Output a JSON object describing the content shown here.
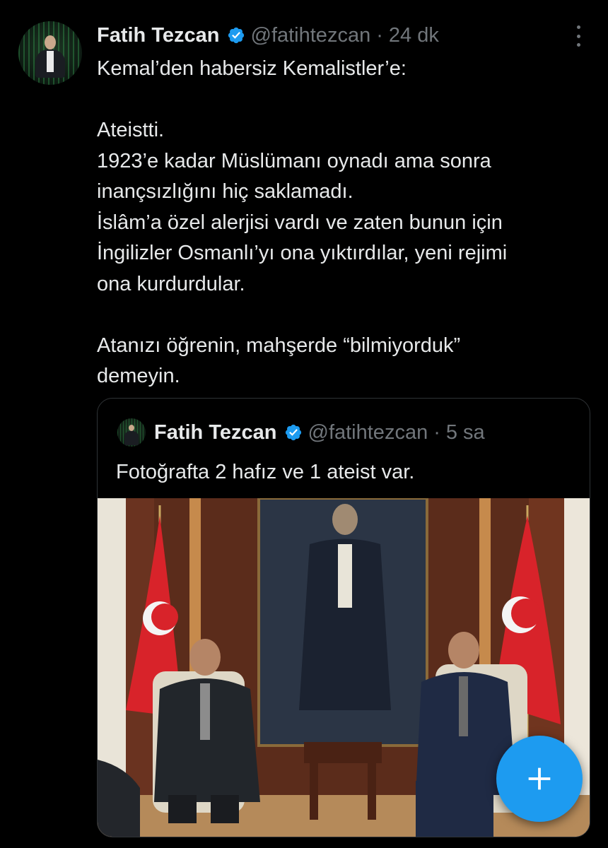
{
  "tweet": {
    "author_name": "Fatih Tezcan",
    "author_handle": "@fatihtezcan",
    "separator": "·",
    "time": "24 dk",
    "text_lines": [
      "Kemal’den habersiz Kemalistler’e:",
      "",
      "Ateistti.",
      "1923’e kadar Müslümanı oynadı ama sonra",
      "inançsızlığını hiç saklamadı.",
      "İslâm’a özel alerjisi vardı ve zaten bunun için",
      "İngilizler Osmanlı’yı ona yıktırdılar, yeni rejimi",
      "ona kurdurdular.",
      "",
      "Atanızı öğrenin, mahşerde “bilmiyorduk”",
      "demeyin."
    ]
  },
  "quote": {
    "author_name": "Fatih Tezcan",
    "author_handle": "@fatihtezcan",
    "separator": "·",
    "time": "5 sa",
    "text": "Fotoğrafta 2 hafız ve 1 ateist var."
  },
  "icons": {
    "verified": "verified-badge-icon",
    "more": "more-options-icon",
    "compose": "plus-icon"
  },
  "colors": {
    "background": "#000000",
    "text": "#e7e9ea",
    "muted": "#71767b",
    "accent": "#1d9bf0",
    "border": "#2f3336"
  }
}
